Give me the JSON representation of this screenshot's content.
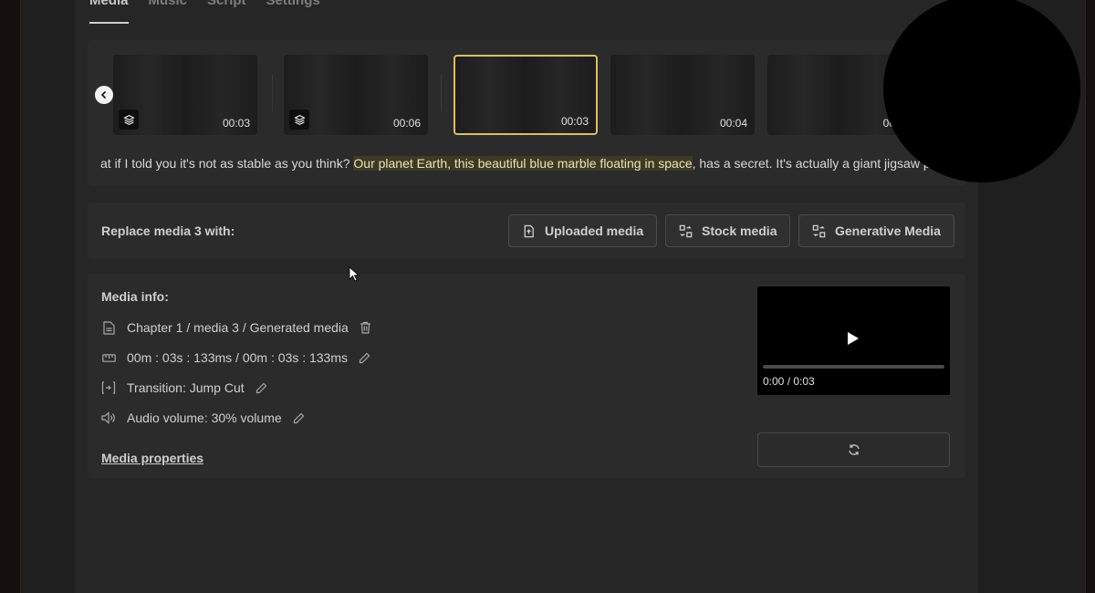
{
  "tabs": [
    {
      "label": "Media",
      "active": true
    },
    {
      "label": "Music",
      "active": false
    },
    {
      "label": "Script",
      "active": false
    },
    {
      "label": "Settings",
      "active": false
    }
  ],
  "thumbnails": [
    {
      "duration": "00:03",
      "has_layers_icon": true,
      "selected": false
    },
    {
      "duration": "00:06",
      "has_layers_icon": true,
      "selected": false
    },
    {
      "duration": "00:03",
      "has_layers_icon": false,
      "selected": true
    },
    {
      "duration": "00:04",
      "has_layers_icon": false,
      "selected": false
    },
    {
      "duration": "00:0",
      "has_layers_icon": false,
      "selected": false
    }
  ],
  "script": {
    "before": "at if I told you it's not as stable as you think? ",
    "highlight": "Our planet Earth, this beautiful blue marble floating in space",
    "after": ", has a secret. It's actually a giant jigsaw p"
  },
  "replace": {
    "label": "Replace media 3 with:",
    "buttons": {
      "uploaded": "Uploaded media",
      "stock": "Stock media",
      "generative": "Generative Media"
    }
  },
  "media_info": {
    "title": "Media info:",
    "path": "Chapter 1 / media 3 / Generated media",
    "timing": "00m : 03s : 133ms / 00m : 03s : 133ms",
    "transition": "Transition: Jump Cut",
    "audio": "Audio volume: 30% volume",
    "properties_link": "Media properties"
  },
  "player": {
    "time": "0:00 / 0:03",
    "progress": 0
  },
  "colors": {
    "accent_selected": "#d9c06a",
    "highlight_bg": "#3d3a25"
  }
}
